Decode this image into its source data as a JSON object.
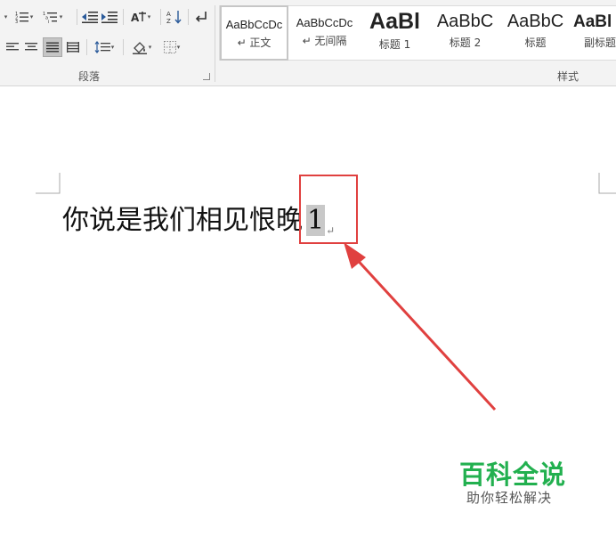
{
  "ribbon": {
    "paragraph_group_label": "段落",
    "styles_group_label": "样式",
    "styles": [
      {
        "sample": "AaBbCcDc",
        "name": "↵ 正文",
        "selected": true
      },
      {
        "sample": "AaBbCcDc",
        "name": "↵ 无间隔",
        "selected": false
      },
      {
        "sample": "AaBl",
        "name": "标题 1",
        "selected": false
      },
      {
        "sample": "AaBbC",
        "name": "标题 2",
        "selected": false
      },
      {
        "sample": "AaBbC",
        "name": "标题",
        "selected": false
      },
      {
        "sample": "AaBl",
        "name": "副标题",
        "selected": false
      }
    ],
    "icons": [
      "bullets-icon",
      "numbering-icon",
      "multilevel-list-icon",
      "decrease-indent-icon",
      "increase-indent-icon",
      "chinese-layout-icon",
      "sort-icon",
      "show-marks-icon",
      "align-left-icon",
      "align-center-icon",
      "justify-icon",
      "distributed-icon",
      "line-spacing-icon",
      "shading-icon",
      "borders-icon"
    ]
  },
  "document": {
    "text": "你说是我们相见恨晚",
    "footnote_ref": "1",
    "paragraph_mark": "↵"
  },
  "annotation": {
    "color": "#e0403f"
  },
  "watermark": {
    "title": "百科全说",
    "subtitle": "助你轻松解决",
    "color": "#22b04f"
  }
}
